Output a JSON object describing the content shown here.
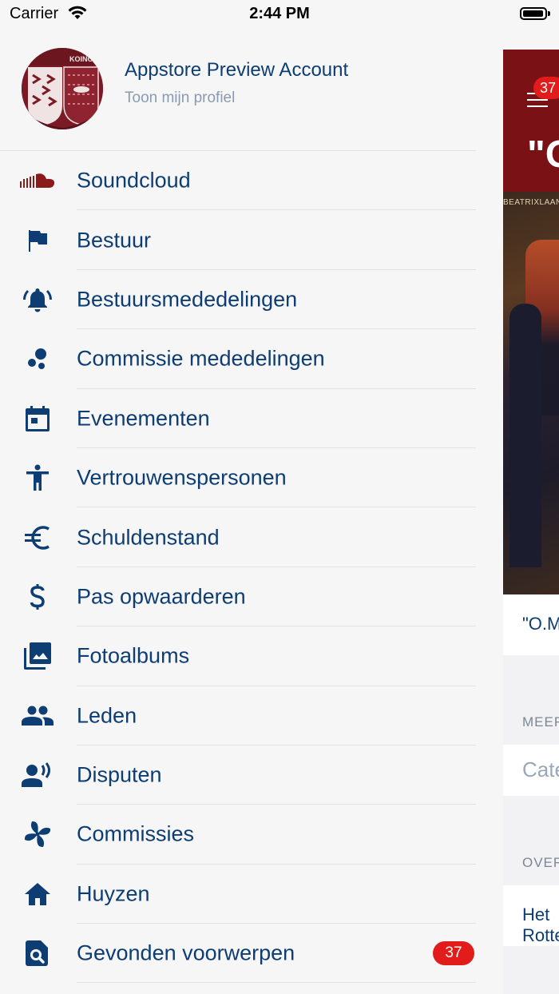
{
  "status_bar": {
    "carrier": "Carrier",
    "time": "2:44 PM"
  },
  "profile": {
    "name": "Appstore Preview Account",
    "subtitle": "Toon mijn profiel",
    "avatar_text": "KOINO"
  },
  "menu": {
    "items": [
      {
        "label": "Soundcloud",
        "icon": "soundcloud-icon"
      },
      {
        "label": "Bestuur",
        "icon": "flag-icon"
      },
      {
        "label": "Bestuursmededelingen",
        "icon": "bell-icon"
      },
      {
        "label": "Commissie mededelingen",
        "icon": "bubbles-icon"
      },
      {
        "label": "Evenementen",
        "icon": "calendar-icon"
      },
      {
        "label": "Vertrouwenspersonen",
        "icon": "person-icon"
      },
      {
        "label": "Schuldenstand",
        "icon": "euro-icon"
      },
      {
        "label": "Pas opwaarderen",
        "icon": "dollar-icon"
      },
      {
        "label": "Fotoalbums",
        "icon": "photo-library-icon"
      },
      {
        "label": "Leden",
        "icon": "people-icon"
      },
      {
        "label": "Disputen",
        "icon": "person-voice-icon"
      },
      {
        "label": "Commissies",
        "icon": "pinwheel-icon"
      },
      {
        "label": "Huyzen",
        "icon": "home-icon"
      },
      {
        "label": "Gevonden voorwerpen",
        "icon": "search-document-icon",
        "badge": "37"
      }
    ]
  },
  "background_view": {
    "badge": "37",
    "hero_title": "\"O",
    "street_sign": "BEATRIXLAAN",
    "card_title": "\"O.M",
    "section1": "MEER",
    "category_placeholder": "Cate",
    "section2": "OVER",
    "card3_line1": "Het",
    "card3_line2": "Rotte"
  },
  "colors": {
    "primary": "#0d3d73",
    "accent_red": "#e21b1b",
    "hero": "#7a1114",
    "soundcloud": "#8b1a1a"
  }
}
